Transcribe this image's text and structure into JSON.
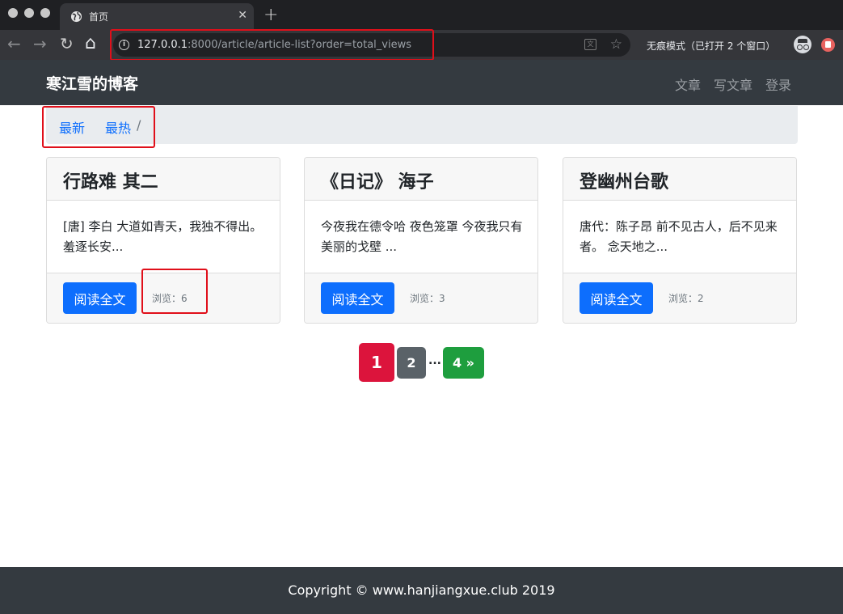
{
  "browser": {
    "tab_title": "首页",
    "tab_close": "✕",
    "new_tab": "+",
    "url_host": "127.0.0.1",
    "url_rest": ":8000/article/article-list?order=total_views",
    "incognito_label": "无痕模式（已打开 2 个窗口）",
    "back_glyph": "←",
    "forward_glyph": "→",
    "reload_glyph": "↻",
    "home_glyph": "⌂",
    "star_glyph": "☆",
    "translate_glyph": "文"
  },
  "navbar": {
    "brand": "寒江雪的博客",
    "links": [
      "文章",
      "写文章",
      "登录"
    ]
  },
  "breadcrumb": {
    "items": [
      "最新",
      "最热"
    ],
    "separator": "/"
  },
  "articles": [
    {
      "title": "行路难 其二",
      "excerpt": "[唐] 李白 大道如青天，我独不得出。 羞逐长安...",
      "button": "阅读全文",
      "views": "浏览：6"
    },
    {
      "title": "《日记》 海子",
      "excerpt": "今夜我在德令哈 夜色笼罩 今夜我只有美丽的戈壁 ...",
      "button": "阅读全文",
      "views": "浏览：3"
    },
    {
      "title": "登幽州台歌",
      "excerpt": "唐代：陈子昂 前不见古人，后不见来者。 念天地之...",
      "button": "阅读全文",
      "views": "浏览：2"
    }
  ],
  "pagination": {
    "current": "1",
    "next": "2",
    "ellipsis": "...",
    "last": "4 »"
  },
  "footer": {
    "text": "Copyright © www.hanjiangxue.club 2019"
  },
  "colors": {
    "primary": "#0d6efd",
    "navbar_bg": "#343a40",
    "page_current": "#dc143c",
    "page_default": "#5a6268",
    "page_last": "#1e9e3e",
    "annotation": "#e00f1a"
  }
}
